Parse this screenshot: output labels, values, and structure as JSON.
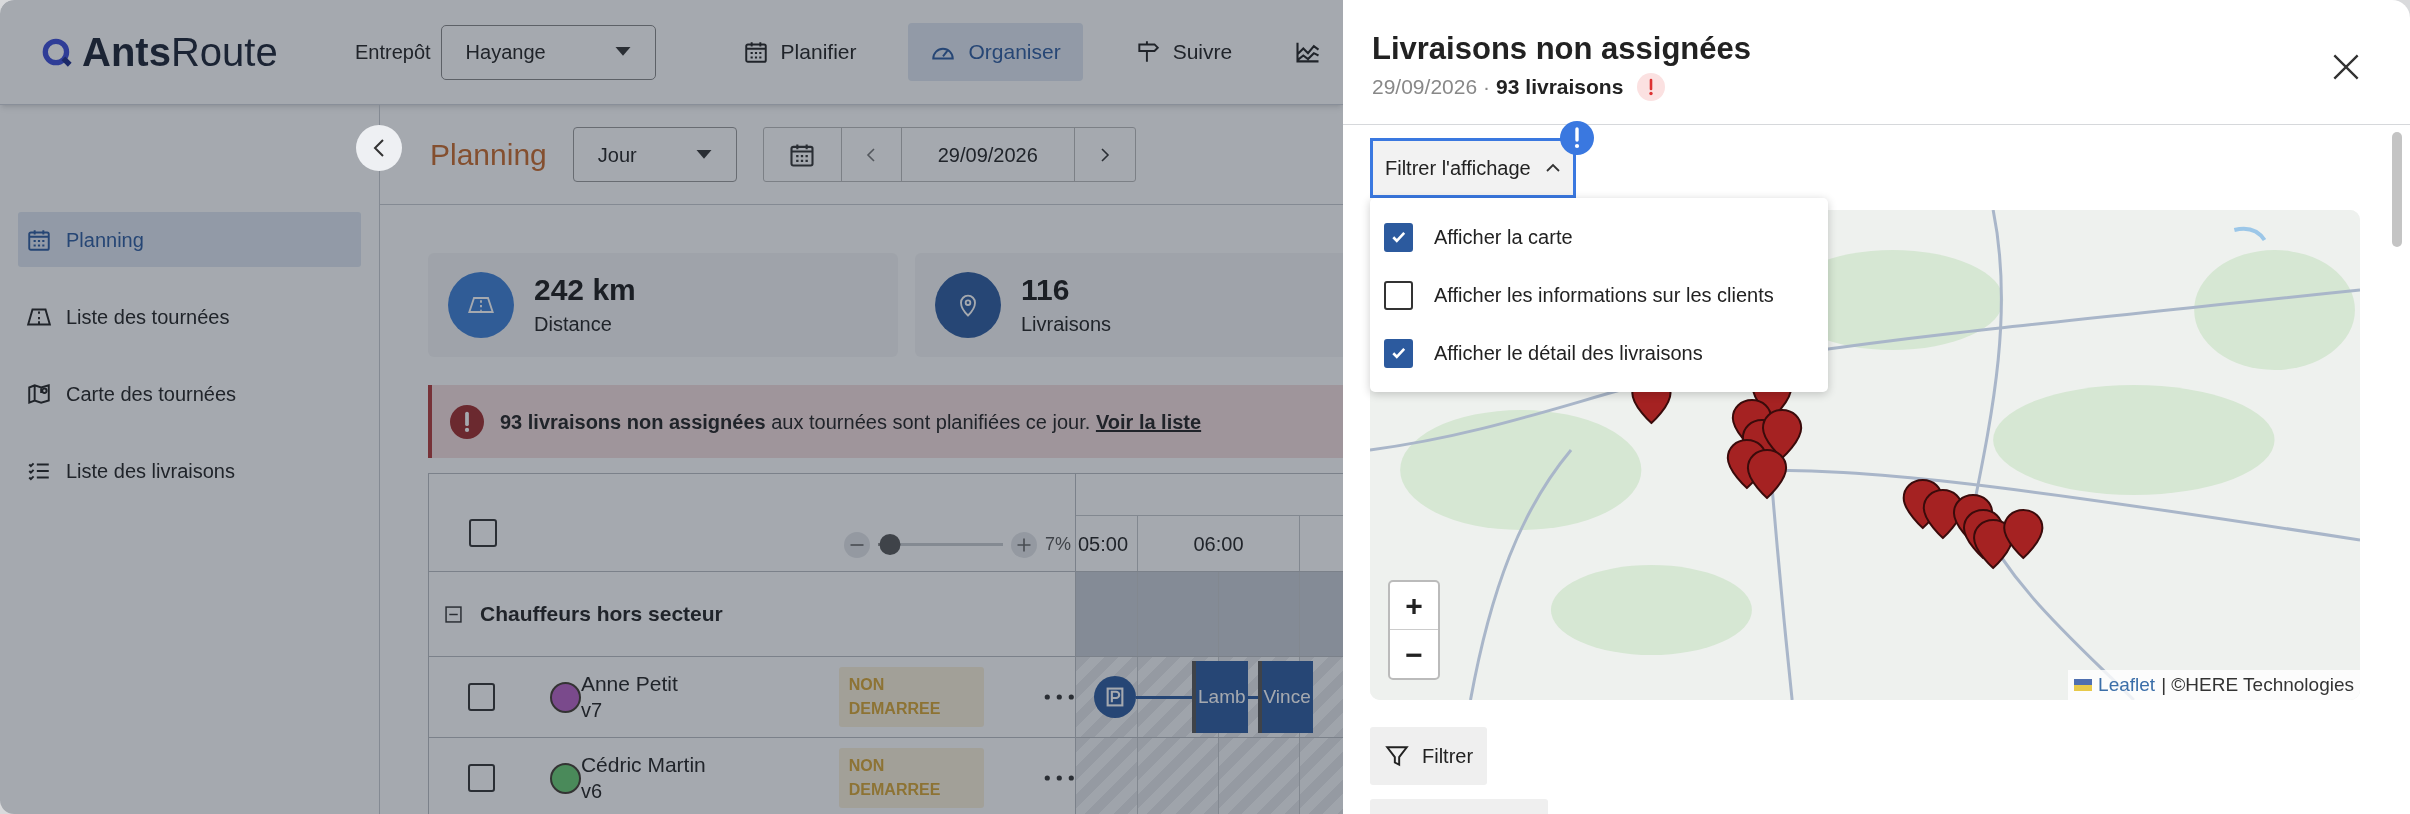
{
  "header": {
    "logo": {
      "bold": "Ants",
      "light": "Route"
    },
    "warehouse": {
      "label": "Entrepôt",
      "value": "Hayange"
    },
    "nav": [
      {
        "kind": "calendar",
        "label": "Planifier",
        "selected": false
      },
      {
        "kind": "gauge",
        "label": "Organiser",
        "selected": true
      },
      {
        "kind": "signpost",
        "label": "Suivre",
        "selected": false
      }
    ]
  },
  "toolbar": {
    "title": "Planning",
    "view": "Jour",
    "date": "29/09/2026"
  },
  "sidebar": {
    "items": [
      {
        "kind": "calendar",
        "label": "Planning",
        "selected": true
      },
      {
        "kind": "road",
        "label": "Liste des tournées",
        "selected": false
      },
      {
        "kind": "map",
        "label": "Carte des tournées",
        "selected": false
      },
      {
        "kind": "list",
        "label": "Liste des livraisons",
        "selected": false
      }
    ]
  },
  "stats": [
    {
      "kind": "distance",
      "value": "242 km",
      "label": "Distance"
    },
    {
      "kind": "deliveries",
      "value": "116",
      "label": "Livraisons"
    }
  ],
  "alert": {
    "text": "**93 livraisons non assignées** aux tournées sont planifiées ce jour.",
    "link": "Voir la liste"
  },
  "planning": {
    "select_all": {
      "checked": false
    },
    "zoom": {
      "level": 0.1,
      "reading": "7%"
    },
    "hours": [
      "05:00",
      "06:00"
    ],
    "groups": [
      {
        "label": "Chauffeurs hors secteur",
        "expanded": true,
        "drivers": [
          {
            "name": "Anne Petit",
            "vehicle": "v7",
            "color": "#7a4a8c",
            "status": "NON DEMARREE",
            "checked": false,
            "stops": [
              "Lamb",
              "Vince"
            ]
          },
          {
            "name": "Cédric Martin",
            "vehicle": "v6",
            "color": "#4a8a5a",
            "status": "NON DEMARREE",
            "checked": false
          }
        ]
      }
    ]
  },
  "panel": {
    "title": "Livraisons non assignées",
    "date": "29/09/2026",
    "separator": "·",
    "count": "93 livraisons",
    "filter": {
      "label": "Filtrer l'affichage",
      "expanded": true,
      "options": [
        {
          "label": "Afficher la carte",
          "checked": true
        },
        {
          "label": "Afficher les informations sur les clients",
          "checked": false
        },
        {
          "label": "Afficher le détail des livraisons",
          "checked": true
        }
      ]
    },
    "map": {
      "zoom_controls": [
        "+",
        "−"
      ],
      "attribution_link": "Leaflet",
      "attribution": "| ©HERE Technologies"
    },
    "filter_button": "Filtrer"
  }
}
